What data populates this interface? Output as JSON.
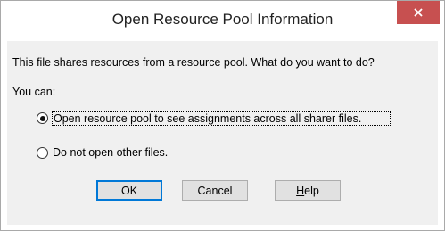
{
  "dialog": {
    "title": "Open Resource Pool Information",
    "close_label": "×",
    "prompt": "This file shares resources from a resource pool. What do you want to do?",
    "you_can": "You can:",
    "options": [
      {
        "label": "Open resource pool to see assignments across all sharer files.",
        "selected": true
      },
      {
        "label": "Do not open other files.",
        "selected": false
      }
    ],
    "buttons": {
      "ok": "OK",
      "cancel": "Cancel",
      "help_prefix": "",
      "help_mnemonic": "H",
      "help_suffix": "elp"
    },
    "colors": {
      "close_button": "#c75050",
      "client_background": "#f0f0f0",
      "default_button_border": "#0078d7"
    }
  }
}
